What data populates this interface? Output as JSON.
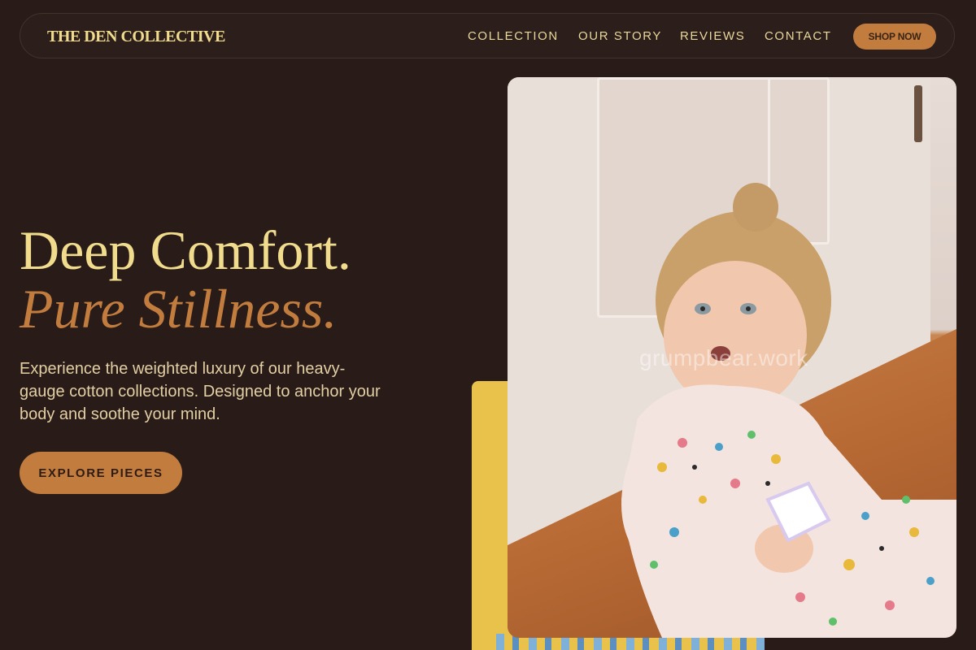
{
  "header": {
    "brand": "THE DEN COLLECTIVE",
    "nav": [
      "COLLECTION",
      "OUR STORY",
      "REVIEWS",
      "CONTACT"
    ],
    "cta": "SHOP NOW"
  },
  "hero": {
    "title_line1": "Deep Comfort.",
    "title_line2": "Pure Stillness.",
    "subtitle": "Experience the weighted luxury of our heavy-gauge cotton collections. Designed to anchor your body and soothe your mind.",
    "button": "EXPLORE PIECES"
  },
  "image": {
    "watermark": "grumpbear.work",
    "subject": "toddler-in-patterned-pajamas"
  },
  "colors": {
    "background": "#281b18",
    "accent_gold": "#f0dc8c",
    "accent_copper": "#c27c3e",
    "yellow": "#e8c24a"
  }
}
